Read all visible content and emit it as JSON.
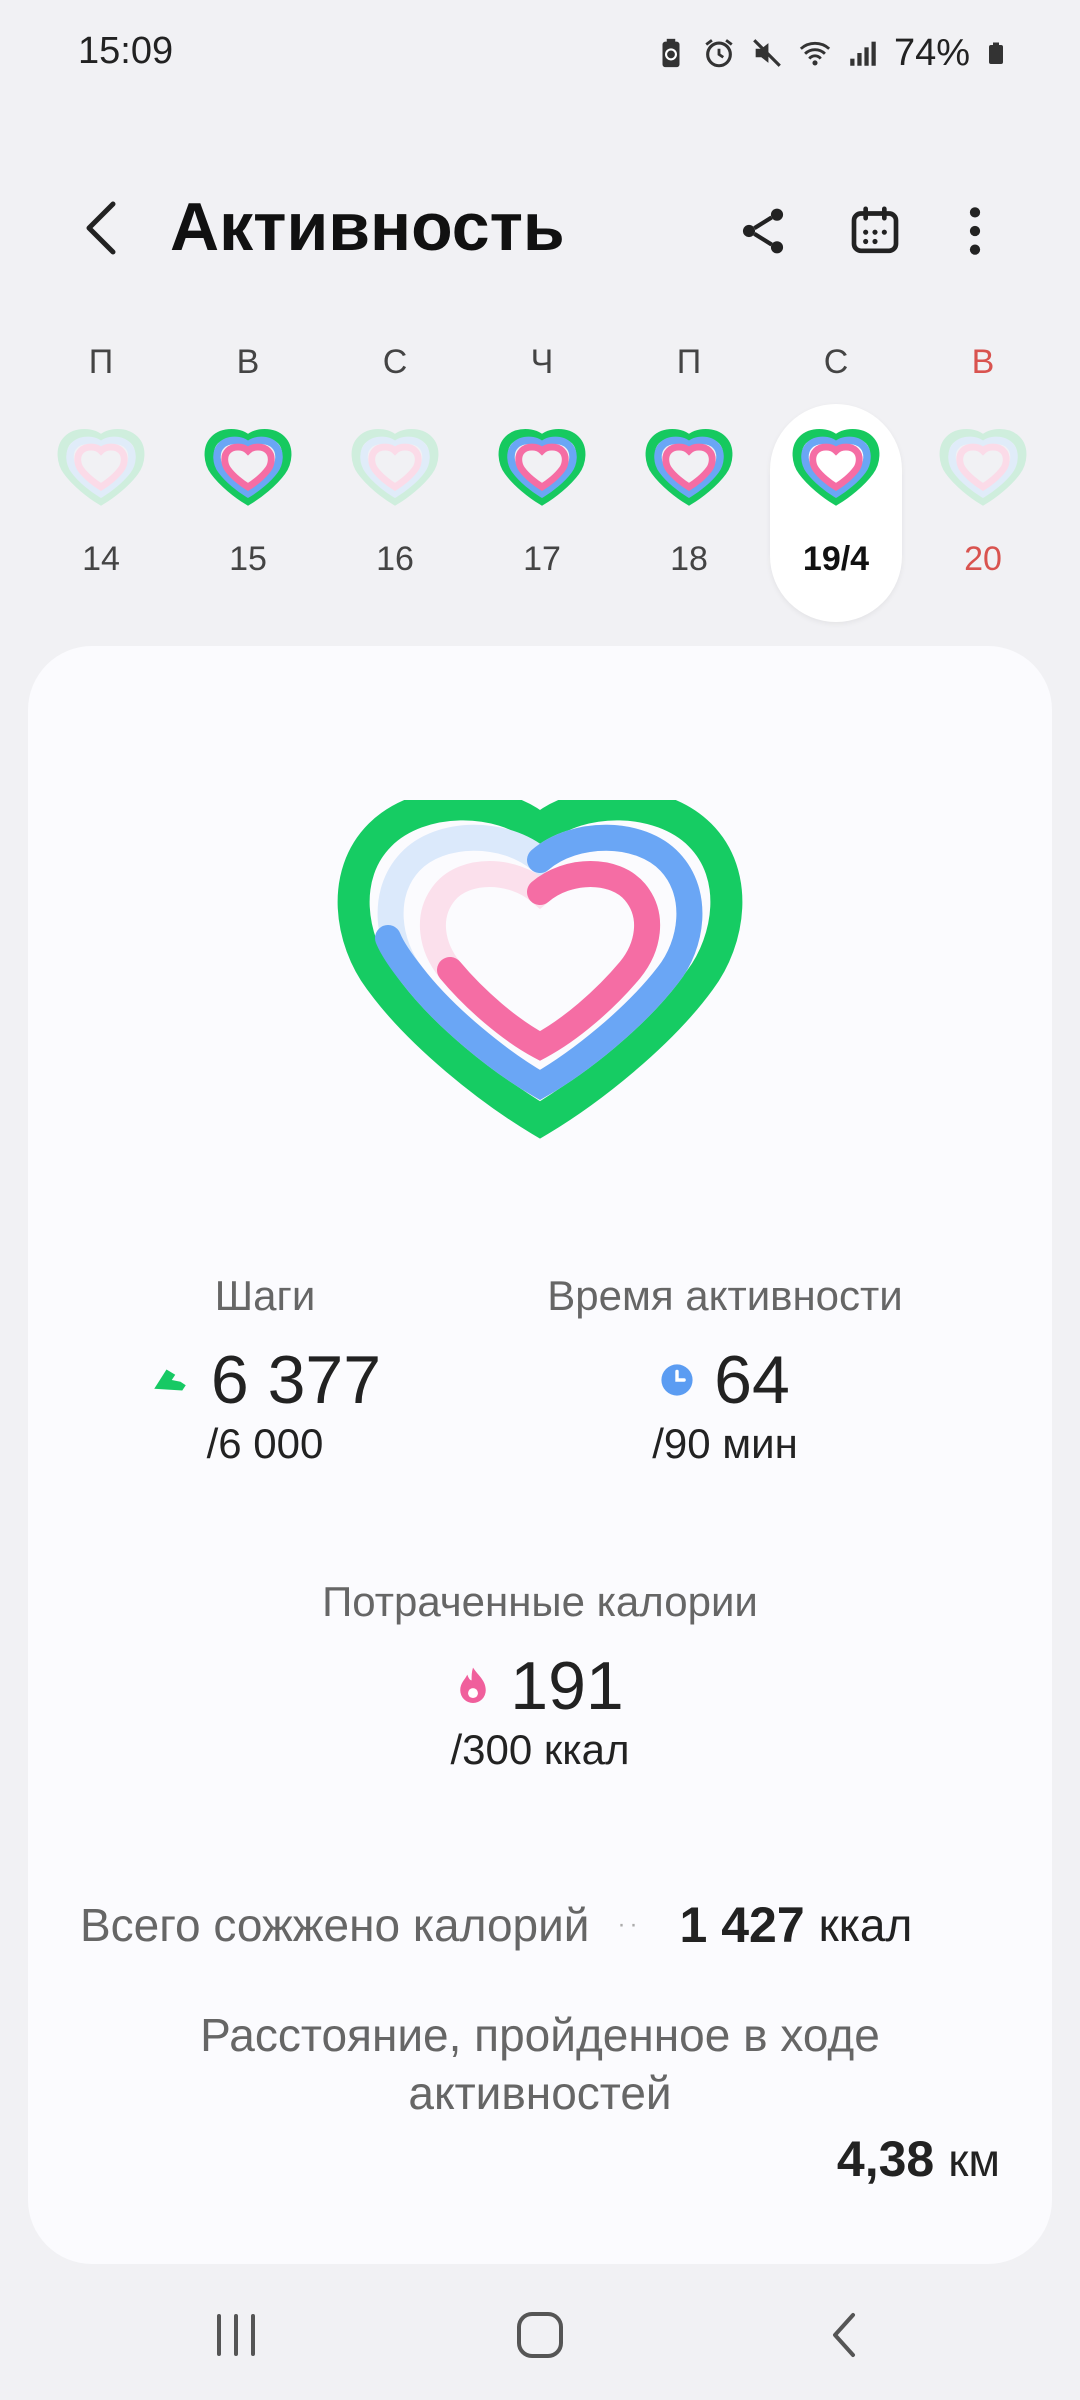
{
  "status_bar": {
    "time": "15:09",
    "battery": "74%"
  },
  "header": {
    "title": "Активность"
  },
  "week": {
    "days": [
      {
        "letter": "П",
        "num": "14",
        "selected": false,
        "weekend": false
      },
      {
        "letter": "В",
        "num": "15",
        "selected": false,
        "weekend": false
      },
      {
        "letter": "С",
        "num": "16",
        "selected": false,
        "weekend": false
      },
      {
        "letter": "Ч",
        "num": "17",
        "selected": false,
        "weekend": false
      },
      {
        "letter": "П",
        "num": "18",
        "selected": false,
        "weekend": false
      },
      {
        "letter": "С",
        "num": "19/4",
        "selected": true,
        "weekend": false
      },
      {
        "letter": "В",
        "num": "20",
        "selected": false,
        "weekend": true
      }
    ]
  },
  "stats": {
    "steps": {
      "label": "Шаги",
      "value": "6 377",
      "goal": "/6 000"
    },
    "active_time": {
      "label": "Время активности",
      "value": "64",
      "goal": "/90 мин"
    },
    "calories": {
      "label": "Потраченные калории",
      "value": "191",
      "goal": "/300 ккал"
    }
  },
  "total": {
    "label": "Всего сожжено калорий",
    "value": "1 427",
    "unit": "ккал"
  },
  "distance": {
    "label": "Расстояние, пройденное в ходе активностей",
    "value": "4,38",
    "unit": "км"
  },
  "colors": {
    "steps_green": "#17c964",
    "active_blue": "#5b9cf2",
    "calories_pink": "#f05f9c",
    "weekend_red": "#d9534f"
  }
}
